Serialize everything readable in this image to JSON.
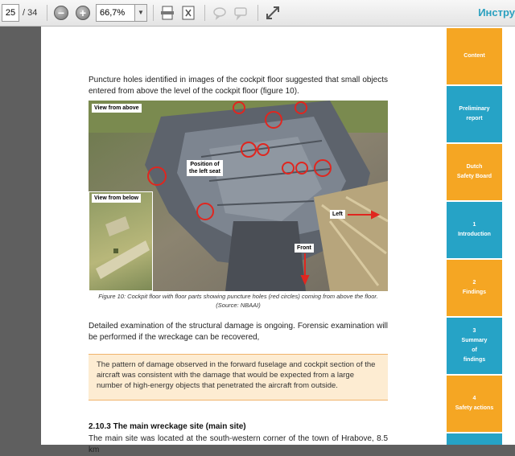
{
  "toolbar": {
    "page_number": "25",
    "page_total": "/ 34",
    "zoom_level": "66,7%",
    "title": "Инстру"
  },
  "document": {
    "intro_paragraph": "Puncture holes identified in images of the cockpit floor suggested that small objects entered from above the level of the cockpit floor (figure 10).",
    "figure": {
      "label_view_above": "View from above",
      "label_view_below": "View from below",
      "label_left_seat_line1": "Position of",
      "label_left_seat_line2": "the left seat",
      "label_left": "Left",
      "label_front": "Front",
      "caption_line1": "Figure 10: Cockpit floor with floor parts showing puncture holes (red circles) coming from above the floor.",
      "caption_line2": "(Source: NBAAI)"
    },
    "paragraph_2": "Detailed examination of the structural damage is ongoing. Forensic examination will be performed if the wreckage can be recovered,",
    "callout": "The pattern of damage observed in the forward fuselage and cockpit section of the aircraft was consistent with the damage that would be expected from a large number of high-energy objects that penetrated the aircraft from outside.",
    "section_heading": "2.10.3  The main wreckage site (main site)",
    "section_text": "The main site was located at the south-western corner of the town of Hrabove, 8.5 km"
  },
  "sidebar": {
    "tabs": [
      {
        "label": "Content",
        "color": "#f5a623"
      },
      {
        "label": "Preliminary\nreport",
        "color": "#26a3c6"
      },
      {
        "label": "Dutch\nSafety Board",
        "color": "#f5a623"
      },
      {
        "label": "1\nIntroduction",
        "color": "#26a3c6"
      },
      {
        "label": "2\nFindings",
        "color": "#f5a623"
      },
      {
        "label": "3\nSummary\nof\nfindings",
        "color": "#26a3c6"
      },
      {
        "label": "4\nSafety actions",
        "color": "#f5a623"
      }
    ]
  }
}
